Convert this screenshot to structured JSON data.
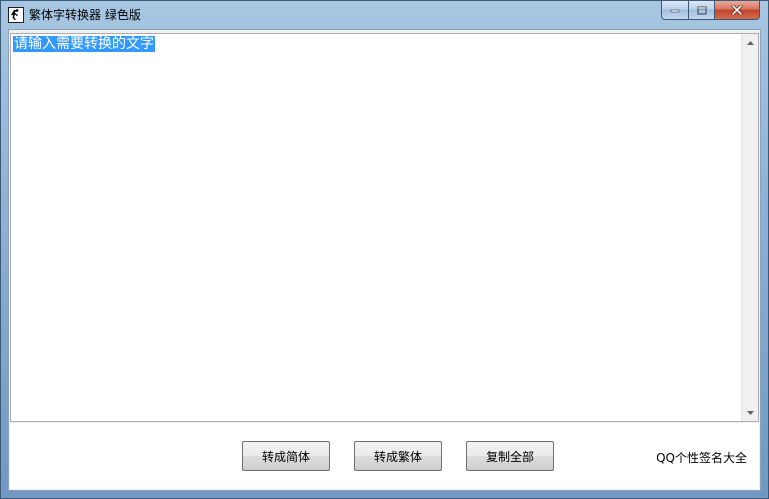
{
  "window": {
    "title": "繁体字转换器 绿色版"
  },
  "editor": {
    "selected_text": "请输入需要转换的文字"
  },
  "buttons": {
    "to_simplified": "转成简体",
    "to_traditional": "转成繁体",
    "copy_all": "复制全部"
  },
  "link": {
    "label": "QQ个性签名大全"
  },
  "colors": {
    "selection": "#3399ff",
    "close_button": "#c2442a"
  },
  "icons": {
    "app": "runner-icon",
    "minimize": "minimize-icon",
    "maximize": "maximize-icon",
    "close": "close-icon",
    "scroll_up": "scroll-up-arrow-icon",
    "scroll_down": "scroll-down-arrow-icon"
  }
}
